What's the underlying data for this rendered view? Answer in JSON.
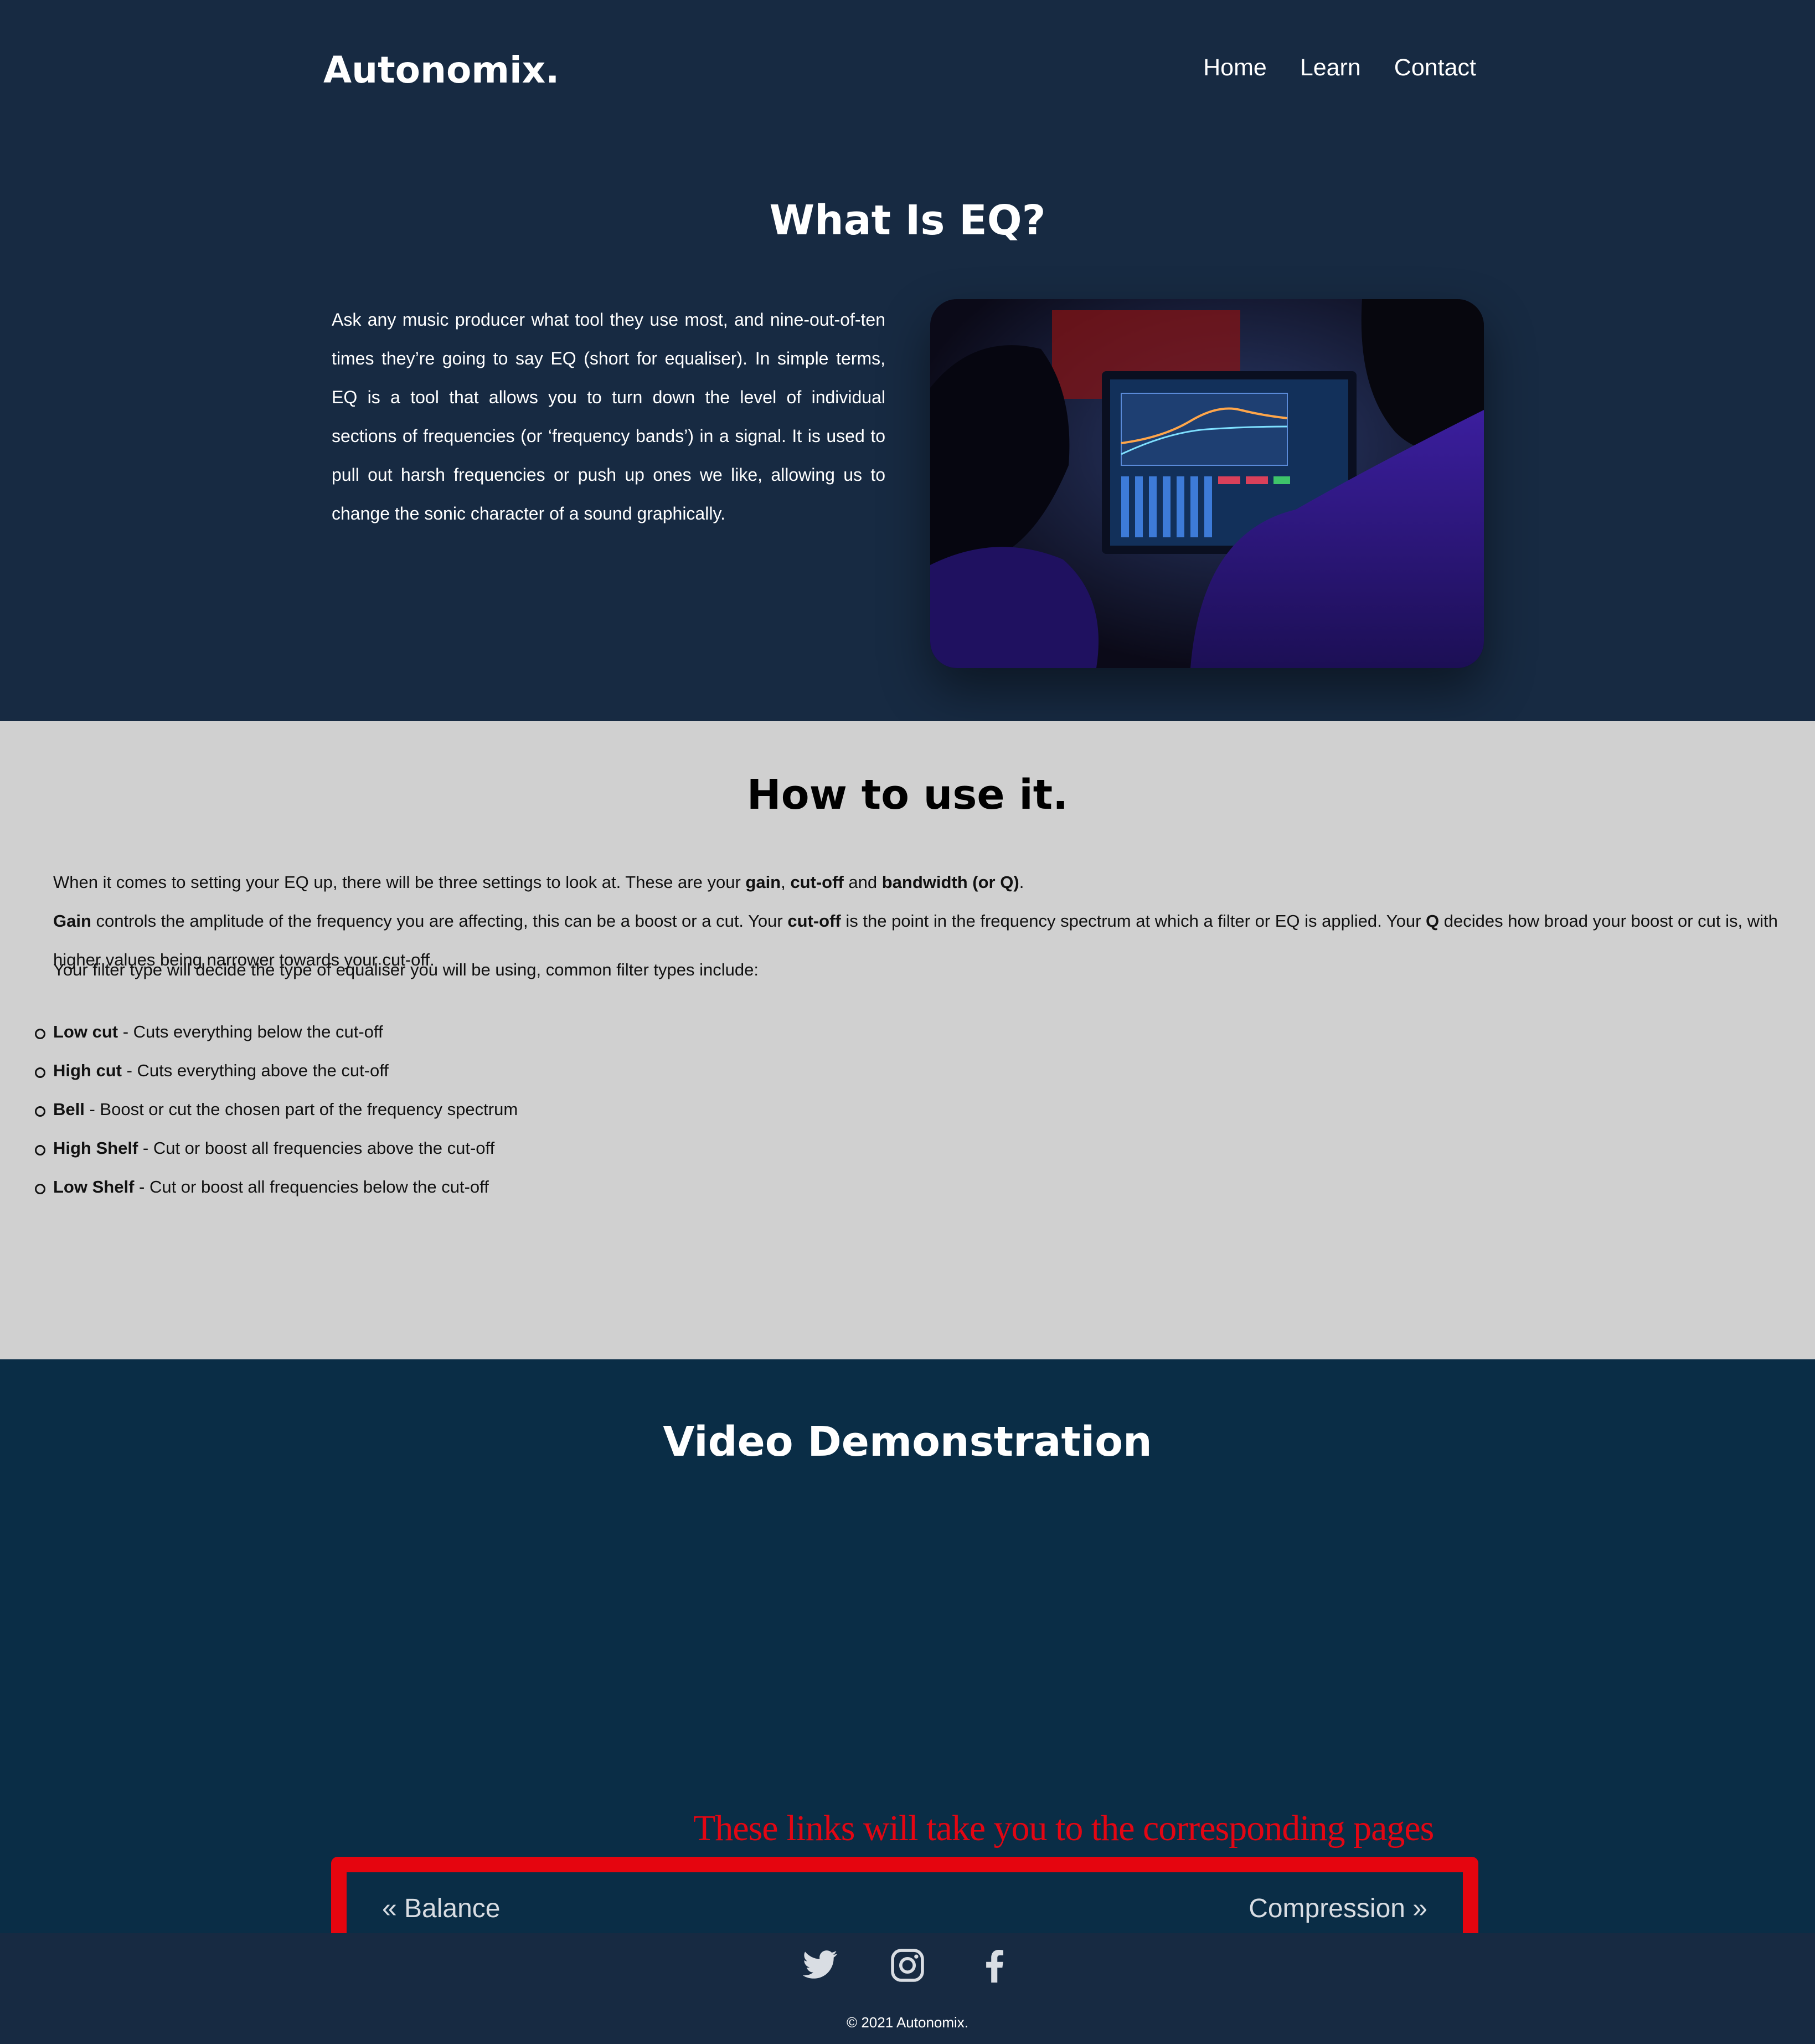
{
  "header": {
    "logo": "Autonomix.",
    "nav": [
      "Home",
      "Learn",
      "Contact"
    ]
  },
  "intro": {
    "title": "What Is EQ?",
    "text": "Ask any music producer what tool they use most, and nine-out-of-ten times they’re going to say EQ (short for equaliser). In simple terms, EQ is a tool that allows you to turn down the level of individual sections of frequencies (or ‘frequency bands’) in a signal. It is used to pull out harsh frequencies or push up ones we like, allowing us to change the sonic character of a sound graphically.",
    "image": "person-at-laptop-with-eq-plugin"
  },
  "howto": {
    "title": "How to use it.",
    "p1_a": "When it comes to setting your EQ up, there will be three settings to look at. These are your ",
    "p1_gain": "gain",
    "p1_b": ", ",
    "p1_cutoff": "cut-off",
    "p1_c": " and ",
    "p1_bw": "bandwidth (or Q)",
    "p1_d": ".",
    "p1_gain2": "Gain",
    "p1_e": " controls the amplitude of the frequency you are affecting, this can be a boost or a cut. Your ",
    "p1_cutoff2": "cut-off",
    "p1_f": " is the point in the frequency spectrum at which a filter or EQ is applied. Your ",
    "p1_q": "Q",
    "p1_g": " decides how broad your boost or cut is, with higher values being narrower towards your cut-off.",
    "p2": "Your filter type will decide the type of equaliser you will be using, common filter types include:",
    "filters": [
      {
        "name": "Low cut",
        "desc": " - Cuts everything below the cut-off"
      },
      {
        "name": "High cut",
        "desc": " - Cuts everything above the cut-off"
      },
      {
        "name": "Bell",
        "desc": " - Boost or cut the chosen part of the frequency spectrum"
      },
      {
        "name": "High Shelf",
        "desc": " - Cut or boost all frequencies above the cut-off"
      },
      {
        "name": "Low Shelf",
        "desc": " - Cut or boost all frequencies below the cut-off"
      }
    ]
  },
  "video": {
    "title": "Video Demonstration",
    "callout": "These links will take you to the corresponding pages",
    "prev": "« Balance",
    "next": "Compression »"
  },
  "footer": {
    "social": [
      "twitter-icon",
      "instagram-icon",
      "facebook-icon"
    ],
    "copyright": "© 2021 Autonomix."
  },
  "colors": {
    "header_bg": "#172a42",
    "howto_bg": "#d0d0d0",
    "video_bg": "#0a2d46",
    "annotation_red": "#e5050f"
  }
}
